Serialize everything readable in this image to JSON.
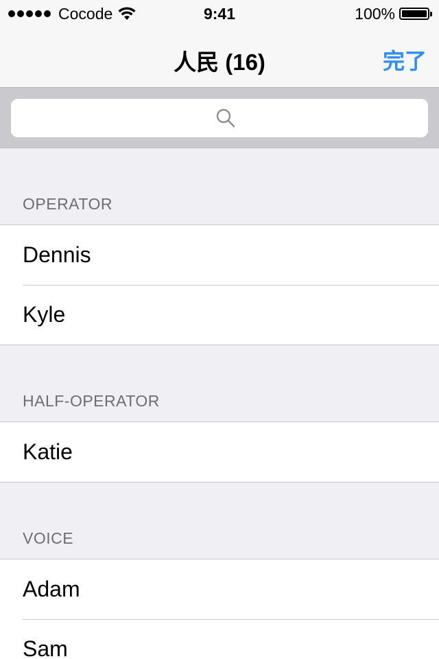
{
  "status_bar": {
    "carrier": "Cocode",
    "time": "9:41",
    "battery": "100%",
    "signal_bars": 5,
    "icons": [
      "wifi-icon",
      "battery-icon"
    ]
  },
  "nav": {
    "title": "人民 (16)",
    "done_label": "完了"
  },
  "search": {
    "placeholder": "",
    "icon": "search-icon"
  },
  "colors": {
    "accent": "#2f8cf0",
    "background": "#efeff4",
    "section_header_text": "#6d6d72"
  },
  "sections": [
    {
      "header": "OPERATOR",
      "items": [
        "Dennis",
        "Kyle"
      ]
    },
    {
      "header": "HALF-OPERATOR",
      "items": [
        "Katie"
      ]
    },
    {
      "header": "VOICE",
      "items": [
        "Adam",
        "Sam"
      ]
    }
  ]
}
